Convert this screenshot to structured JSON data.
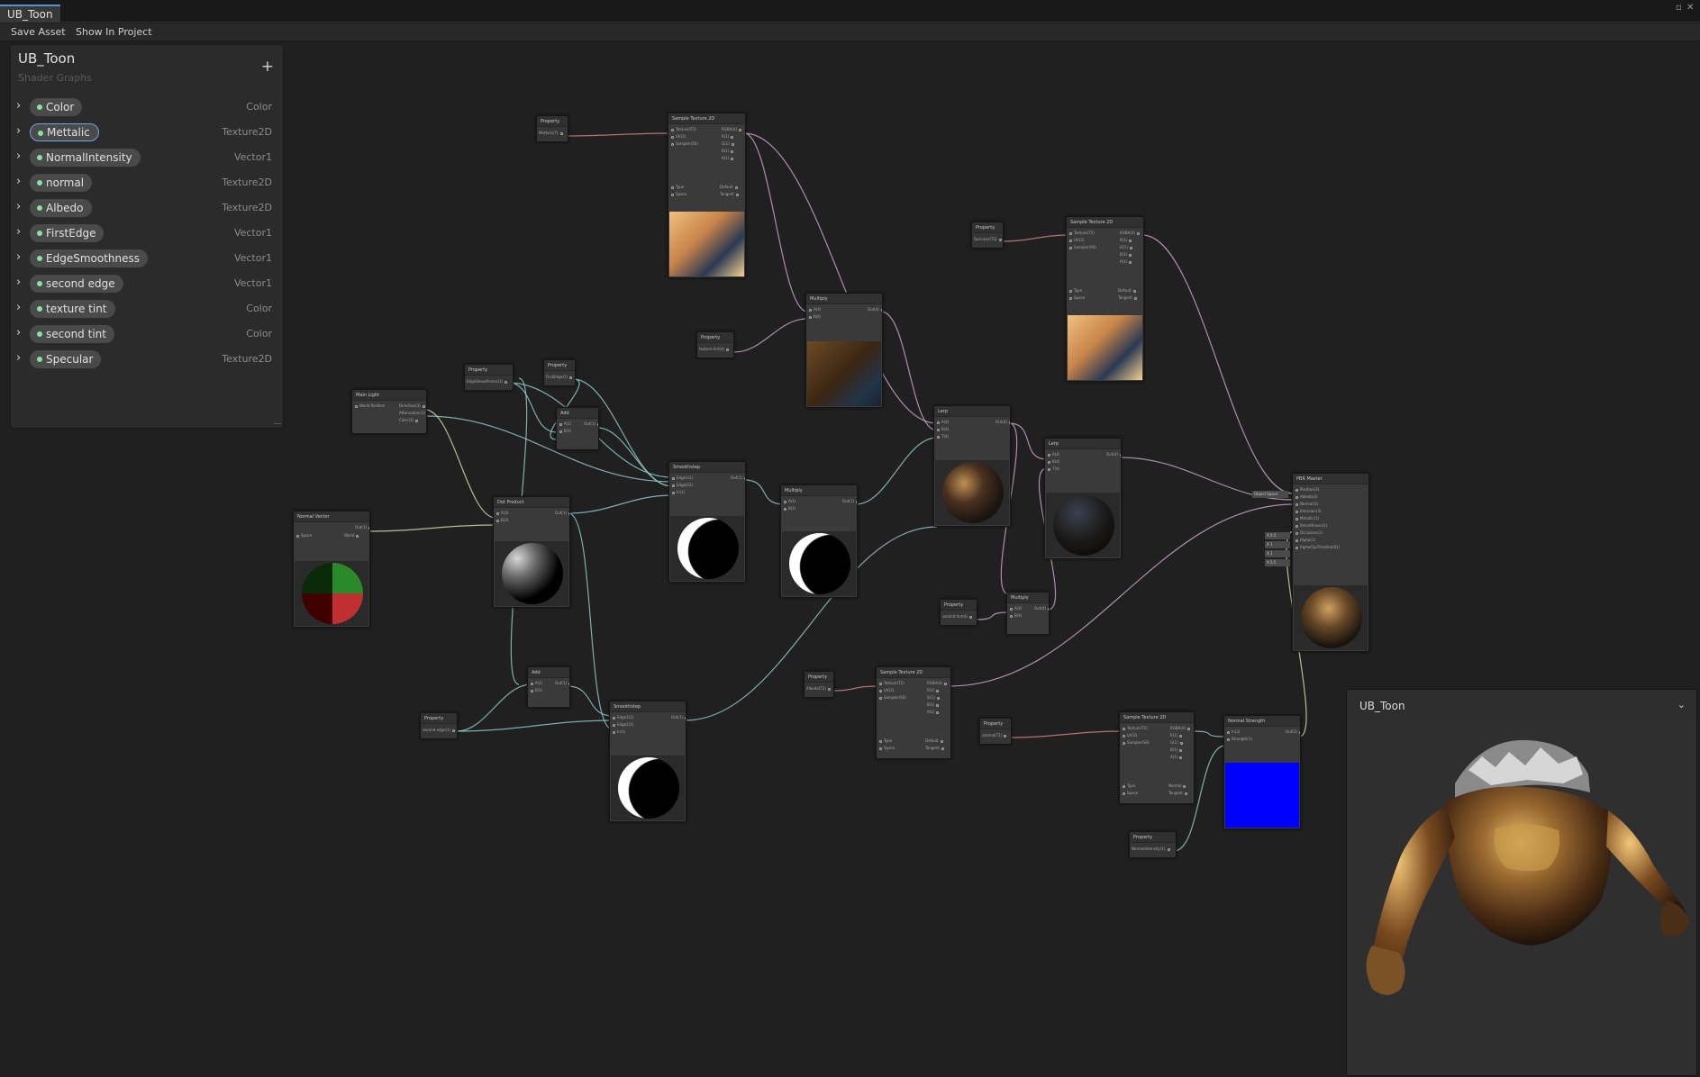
{
  "window": {
    "tab_title": "UB_Toon",
    "controls": [
      "▫",
      "✕"
    ]
  },
  "toolbar": {
    "save_asset": "Save Asset",
    "show_in_project": "Show In Project"
  },
  "blackboard": {
    "title": "UB_Toon",
    "subtitle": "Shader Graphs",
    "add_symbol": "+",
    "chevron": "›",
    "properties": [
      {
        "name": "Color",
        "type": "Color"
      },
      {
        "name": "Mettalic",
        "type": "Texture2D",
        "selected": true
      },
      {
        "name": "NormalIntensity",
        "type": "Vector1"
      },
      {
        "name": "normal",
        "type": "Texture2D"
      },
      {
        "name": "Albedo",
        "type": "Texture2D"
      },
      {
        "name": "FirstEdge",
        "type": "Vector1"
      },
      {
        "name": "EdgeSmoothness",
        "type": "Vector1"
      },
      {
        "name": "second edge",
        "type": "Vector1"
      },
      {
        "name": "texture tint",
        "type": "Color"
      },
      {
        "name": "second  tint",
        "type": "Color"
      },
      {
        "name": "Specular",
        "type": "Texture2D"
      }
    ]
  },
  "nodes": {
    "prop_metallic": {
      "title": "Property",
      "port": "Mettalic(T)"
    },
    "sample_tex_1": {
      "title": "Sample Texture 2D",
      "in": [
        "Texture(T2)",
        "UV(2)",
        "Sampler(SS)"
      ],
      "out": [
        "RGBA(4)",
        "R(1)",
        "G(1)",
        "B(1)",
        "A(1)"
      ],
      "type_label": "Type",
      "space_label": "Space",
      "type_val": "Default",
      "space_val": "Tangent"
    },
    "prop_specular": {
      "title": "Property",
      "port": "Specular(T2)"
    },
    "sample_tex_2": {
      "title": "Sample Texture 2D",
      "in": [
        "Texture(T2)",
        "UV(2)",
        "Sampler(SS)"
      ],
      "out": [
        "RGBA(4)",
        "R(1)",
        "G(1)",
        "B(1)",
        "A(1)"
      ],
      "type_label": "Type",
      "space_label": "Space",
      "type_val": "Default",
      "space_val": "Tangent"
    },
    "multiply_1": {
      "title": "Multiply",
      "in": [
        "A(4)",
        "B(4)"
      ],
      "out": "Out(4)"
    },
    "prop_texture_tint": {
      "title": "Property",
      "port": "texture tint(4)"
    },
    "prop_edge_smooth": {
      "title": "Property",
      "port": "EdgeSmoothness(1)"
    },
    "prop_first_edge": {
      "title": "Property",
      "port": "FirstEdge(1)"
    },
    "main_light": {
      "title": "Main Light",
      "in": "World Position",
      "out": [
        "Direction(3)",
        "Attenuation(1)",
        "Color(3)"
      ],
      "space": "World Space"
    },
    "add_1": {
      "title": "Add",
      "in": [
        "A(1)",
        "B(1)"
      ],
      "out": "Out(1)"
    },
    "lerp_1": {
      "title": "Lerp",
      "in": [
        "A(4)",
        "B(4)",
        "T(4)"
      ],
      "out": "Out(4)"
    },
    "lerp_2": {
      "title": "Lerp",
      "in": [
        "A(4)",
        "B(4)",
        "T(4)"
      ],
      "out": "Out(4)"
    },
    "smoothstep_1": {
      "title": "Smoothstep",
      "in": [
        "Edge1(1)",
        "Edge2(1)",
        "In(1)"
      ],
      "out": "Out(1)"
    },
    "multiply_2": {
      "title": "Multiply",
      "in": [
        "A(1)",
        "B(1)"
      ],
      "out": "Out(1)"
    },
    "normal_vector": {
      "title": "Normal Vector",
      "out": "Out(3)",
      "space_label": "Space",
      "space_val": "World"
    },
    "dot_product": {
      "title": "Dot Product",
      "in": [
        "A(3)",
        "B(3)"
      ],
      "out": "Out(1)"
    },
    "pbr_master": {
      "title": "PBR Master",
      "in": [
        "Position(3)",
        "Albedo(3)",
        "Normal(3)",
        "Emission(3)",
        "Metallic(1)",
        "Smoothness(1)",
        "Occlusion(1)",
        "Alpha(1)",
        "AlphaClipThreshold(1)"
      ],
      "defaults": [
        "X 0.5",
        "X 1",
        "X 1",
        "X 0.5"
      ],
      "object_space": "Object Space"
    },
    "prop_second_tint": {
      "title": "Property",
      "port": "second  tint(4)"
    },
    "multiply_3": {
      "title": "Multiply",
      "in": [
        "A(4)",
        "B(4)"
      ],
      "out": "Out(4)"
    },
    "add_2": {
      "title": "Add",
      "in": [
        "A(1)",
        "B(1)"
      ],
      "out": "Out(1)"
    },
    "prop_second_edge": {
      "title": "Property",
      "port": "second edge(1)"
    },
    "smoothstep_2": {
      "title": "Smoothstep",
      "in": [
        "Edge1(1)",
        "Edge2(1)",
        "In(1)"
      ],
      "out": "Out(1)"
    },
    "prop_albedo": {
      "title": "Property",
      "port": "Albedo(T2)"
    },
    "sample_tex_3": {
      "title": "Sample Texture 2D",
      "in": [
        "Texture(T2)",
        "UV(2)",
        "Sampler(SS)"
      ],
      "out": [
        "RGBA(4)",
        "R(1)",
        "G(1)",
        "B(1)",
        "A(1)"
      ],
      "type_label": "Type",
      "space_label": "Space",
      "type_val": "Default",
      "space_val": "Tangent"
    },
    "prop_normal": {
      "title": "Property",
      "port": "normal(T2)"
    },
    "sample_tex_4": {
      "title": "Sample Texture 2D",
      "in": [
        "Texture(T2)",
        "UV(2)",
        "Sampler(SS)"
      ],
      "out": [
        "RGBA(4)",
        "R(1)",
        "G(1)",
        "B(1)",
        "A(1)"
      ],
      "type_label": "Type",
      "space_label": "Space",
      "type_val": "Normal",
      "space_val": "Tangent"
    },
    "normal_strength": {
      "title": "Normal Strength",
      "in": [
        "In(3)",
        "Strength(1)"
      ],
      "out": "Out(3)"
    },
    "prop_normal_intensity": {
      "title": "Property",
      "port": "NormalIntensity(1)"
    }
  },
  "main_preview": {
    "title": "UB_Toon",
    "chevron": "⌄"
  }
}
